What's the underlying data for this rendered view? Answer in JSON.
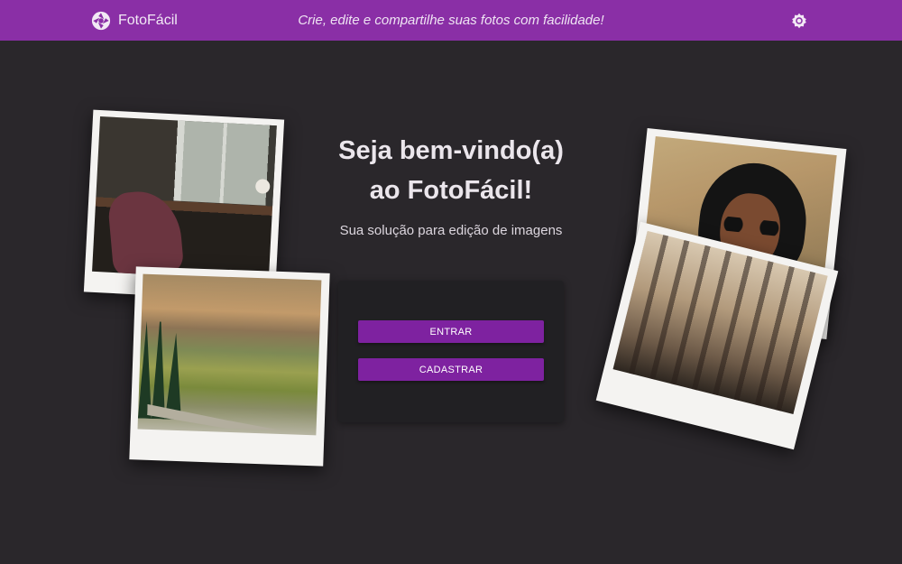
{
  "header": {
    "app_name": "FotoFácil",
    "logo_icon": "camera-aperture-icon",
    "tagline": "Crie, edite e compartilhe suas fotos com facilidade!",
    "theme_icon": "brightness-icon",
    "background_color": "#8a2fa6"
  },
  "hero": {
    "title_line1": "Seja bem-vindo(a)",
    "title_line2": "ao FotoFácil!",
    "subtitle": "Sua solução para edição de imagens"
  },
  "auth_card": {
    "enter_label": "ENTRAR",
    "register_label": "CADASTRAR",
    "button_color": "#7e22a0"
  },
  "photos": [
    {
      "subject": "interior with chair and desk by window"
    },
    {
      "subject": "mountain landscape with forest and road"
    },
    {
      "subject": "woman with sunglasses"
    },
    {
      "subject": "old buildings with balconies"
    }
  ],
  "colors": {
    "page_background": "#2a272b",
    "card_background": "#212023"
  }
}
